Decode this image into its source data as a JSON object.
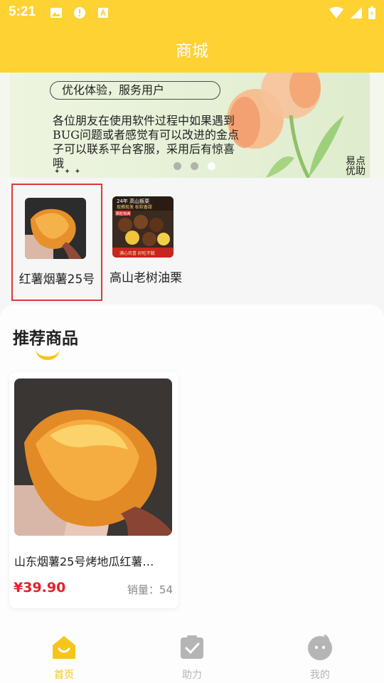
{
  "status_bar": {
    "time": "5:21"
  },
  "header": {
    "title": "商城"
  },
  "banner": {
    "slogan": "优化体验，服务用户",
    "message": "各位朋友在使用软件过程中如果遇到BUG问题或者感觉有可以改进的金点子可以联系平台客服，采用后有惊喜哦",
    "brand": "易点优助",
    "dots_count": 3,
    "active_dot": 2
  },
  "categories": [
    {
      "label": "红薯烟薯25号",
      "selected": true
    },
    {
      "label": "高山老树油栗",
      "selected": false
    }
  ],
  "chestnut_thumb": {
    "line1": "24年 高山板栗",
    "line2": "现摘现发 松软香甜",
    "line3": "颗粒饱满",
    "line4": "满心欢喜 好吃不腻"
  },
  "recommend": {
    "title": "推荐商品",
    "products": [
      {
        "name": "山东烟薯25号烤地瓜红薯…",
        "price": "¥39.90",
        "sales_label": "销量：",
        "sales": "54"
      }
    ]
  },
  "nav": {
    "items": [
      {
        "label": "首页",
        "active": true
      },
      {
        "label": "助力",
        "active": false
      },
      {
        "label": "我的",
        "active": false
      }
    ],
    "active_color": "#f5c518",
    "inactive_color": "#b5b5b5"
  },
  "colors": {
    "header": "#fdd232",
    "price": "#e5202a",
    "selected_border": "#e0373a"
  }
}
